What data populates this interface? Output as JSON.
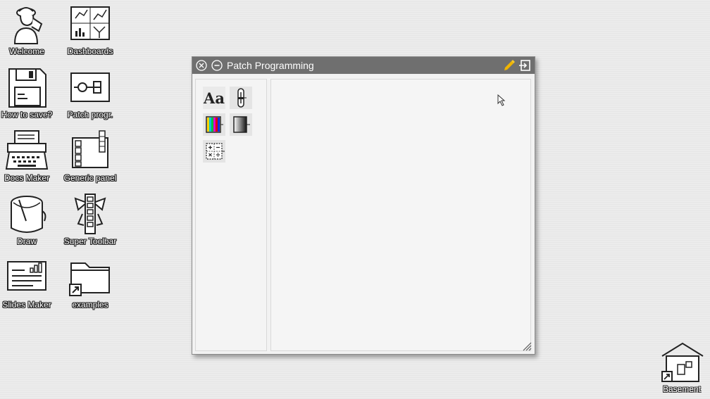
{
  "desktop": {
    "icons": [
      {
        "label": "Welcome",
        "icon": "welcome-person-icon"
      },
      {
        "label": "Dashboards",
        "icon": "dashboards-icon"
      },
      {
        "label": "How to save?",
        "icon": "floppy-disk-icon"
      },
      {
        "label": "Patch progr.",
        "icon": "patch-programming-icon"
      },
      {
        "label": "Docs Maker",
        "icon": "typewriter-icon"
      },
      {
        "label": "Generic panel",
        "icon": "generic-panel-icon"
      },
      {
        "label": "Draw",
        "icon": "paint-bucket-icon"
      },
      {
        "label": "Super Toolbar",
        "icon": "super-toolbar-icon"
      },
      {
        "label": "Slides Maker",
        "icon": "slides-icon"
      },
      {
        "label": "examples",
        "icon": "folder-shortcut-icon"
      }
    ],
    "basement": {
      "label": "Basement",
      "icon": "basement-house-icon"
    }
  },
  "window": {
    "title": "Patch Programming",
    "close_icon": "close-circle-icon",
    "minimize_icon": "minimize-circle-icon",
    "edit_icon": "pencil-icon",
    "exit_icon": "exit-icon",
    "palette": {
      "tools": [
        {
          "name": "text",
          "label": "Aa",
          "icon": "text-tool-icon"
        },
        {
          "name": "slider",
          "icon": "slider-tool-icon"
        },
        {
          "name": "color",
          "icon": "color-bars-tool-icon"
        },
        {
          "name": "gradient",
          "icon": "gradient-tool-icon"
        },
        {
          "name": "math",
          "icon": "math-operators-tool-icon"
        }
      ]
    }
  },
  "colors": {
    "titlebar": "#6f6f6f",
    "pencil": "#f0b400",
    "desktop": "#ececec"
  }
}
